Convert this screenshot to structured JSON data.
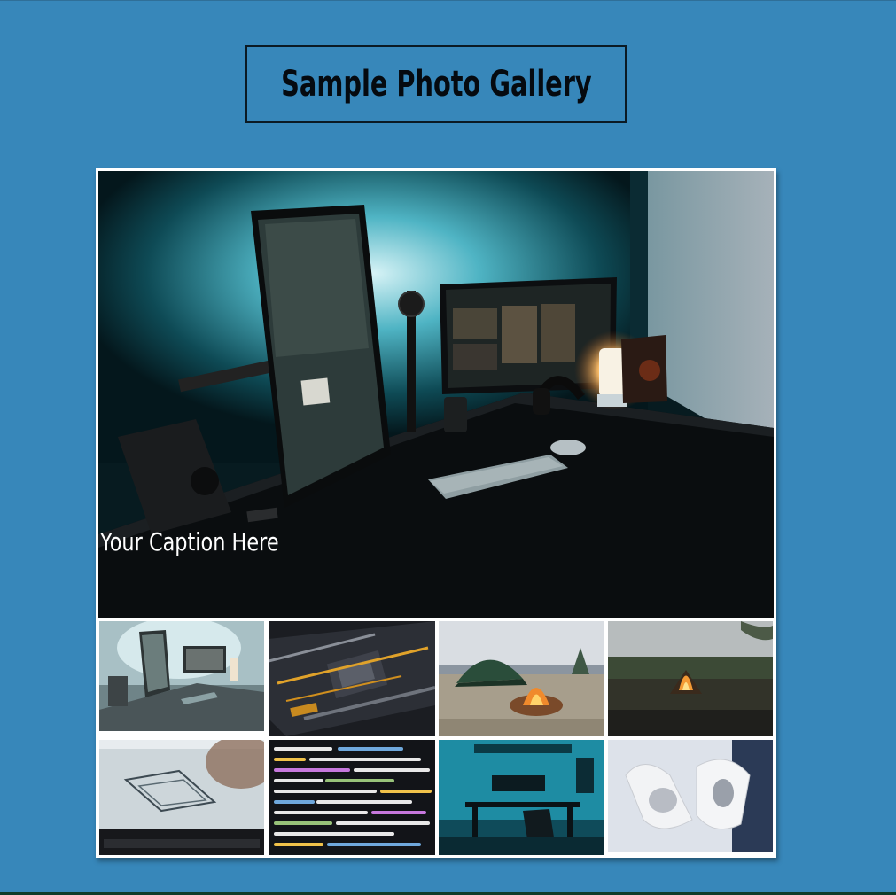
{
  "page": {
    "title": "Sample Photo Gallery"
  },
  "gallery": {
    "caption": "Your Caption Here",
    "main_image": {
      "subject": "desk setup with vertical monitor and teal backlight"
    },
    "thumbnails": [
      {
        "subject": "desk setup with monitors"
      },
      {
        "subject": "circuit board close-up"
      },
      {
        "subject": "tent with campfire on rocks"
      },
      {
        "subject": "campfire in open field"
      },
      {
        "subject": "laptop with 3D design"
      },
      {
        "subject": "code on screen"
      },
      {
        "subject": "gaming desk with neon lights"
      },
      {
        "subject": "gloved hands holding 3D printed objects"
      }
    ]
  },
  "colors": {
    "background": "#3787ba",
    "frame": "#ffffff",
    "title_text": "#050a10",
    "caption_text": "#ffffff"
  }
}
